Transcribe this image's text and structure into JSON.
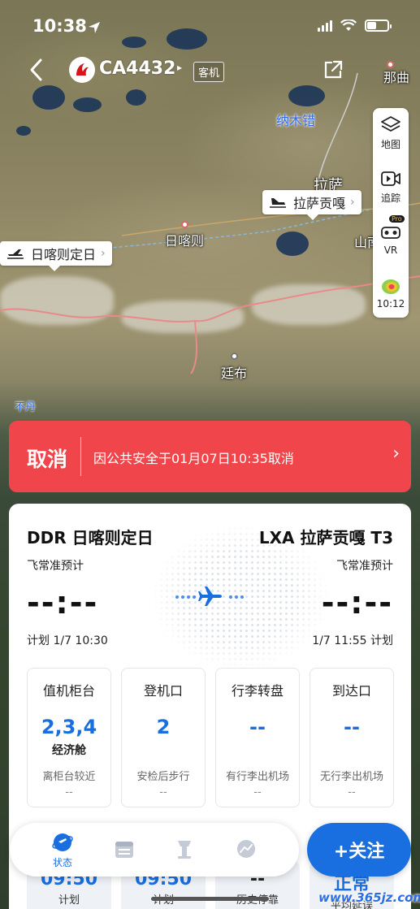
{
  "status_bar": {
    "time": "10:38"
  },
  "nav": {
    "flight_number": "CA4432",
    "aircraft_tag": "客机"
  },
  "map": {
    "labels": {
      "namtso": "纳木错",
      "lhasa": "拉萨",
      "nagqu": "那曲",
      "shigatse": "日喀则",
      "shannan": "山南",
      "tingri": "廷布",
      "bottom_left": "不丹"
    },
    "callouts": {
      "departure": "日喀则定日",
      "arrival": "拉萨贡嘎"
    }
  },
  "toolbar": {
    "items": [
      {
        "label": "地图",
        "icon": "layers-icon"
      },
      {
        "label": "追踪",
        "icon": "video-icon"
      },
      {
        "label": "VR",
        "icon": "vr-icon",
        "badge": "Pro"
      },
      {
        "label": "10:12",
        "icon": "weather-radar-icon"
      }
    ]
  },
  "cancel": {
    "title": "取消",
    "reason": "因公共安全于01月07日10:35取消"
  },
  "flight": {
    "departure": {
      "airport": "DDR 日喀则定日",
      "ontime_label": "飞常准预计",
      "time": "--:--",
      "plan_label": "计划",
      "plan_time": "1/7 10:30"
    },
    "arrival": {
      "airport": "LXA 拉萨贡嘎 T3",
      "ontime_label": "飞常准预计",
      "time": "--:--",
      "plan_label": "计划",
      "plan_time": "1/7 11:55"
    }
  },
  "info_boxes": [
    {
      "title": "值机柜台",
      "value": "2,3,4",
      "sub": "经济舱",
      "note": "离柜台较近",
      "note2": "--"
    },
    {
      "title": "登机口",
      "value": "2",
      "sub": "",
      "note": "安检后步行",
      "note2": "--"
    },
    {
      "title": "行李转盘",
      "value": "--",
      "sub": "",
      "note": "有行李出机场",
      "note2": "--"
    },
    {
      "title": "到达口",
      "value": "--",
      "sub": "",
      "note": "无行李出机场",
      "note2": "--"
    }
  ],
  "peek_row": [
    {
      "value": "09:50",
      "label": "计划"
    },
    {
      "value": "09:50",
      "label": "计划"
    },
    {
      "value": "--",
      "label": "历史停靠"
    },
    {
      "value": "正常",
      "label": "平均延误"
    }
  ],
  "bottom_nav": {
    "items": [
      {
        "label": "状态",
        "icon": "globe-plane-icon",
        "active": true
      },
      {
        "label": "",
        "icon": "calendar-icon",
        "active": false
      },
      {
        "label": "",
        "icon": "tower-icon",
        "active": false
      },
      {
        "label": "",
        "icon": "trend-icon",
        "active": false
      }
    ],
    "follow_label": "+关注"
  },
  "watermark": "www.365jz.com",
  "colors": {
    "accent": "#1a6fe0",
    "cancel": "#f0464b"
  }
}
